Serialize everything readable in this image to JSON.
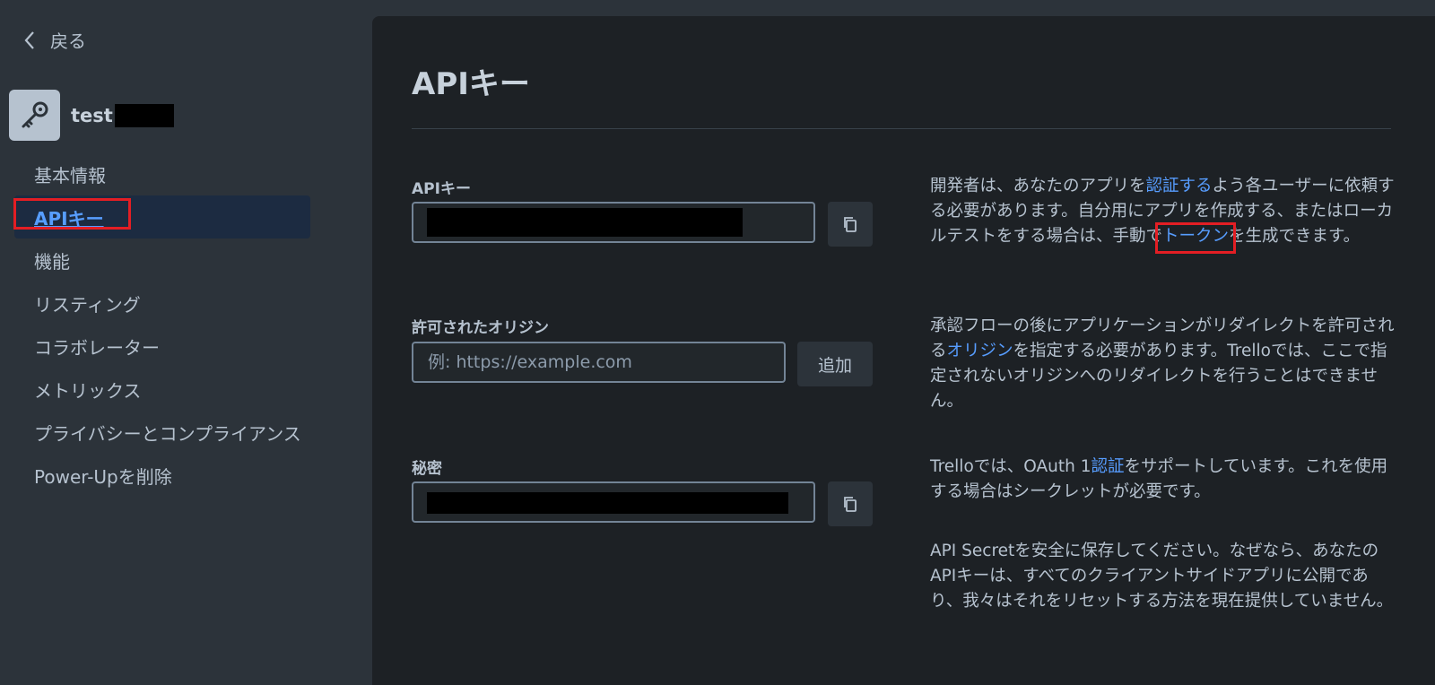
{
  "sidebar": {
    "back_label": "戻る",
    "app_name": "test",
    "nav": [
      {
        "label": "基本情報"
      },
      {
        "label": "APIキー"
      },
      {
        "label": "機能"
      },
      {
        "label": "リスティング"
      },
      {
        "label": "コラボレーター"
      },
      {
        "label": "メトリックス"
      },
      {
        "label": "プライバシーとコンプライアンス"
      },
      {
        "label": "Power-Upを削除"
      }
    ],
    "active_index": 1
  },
  "main": {
    "title": "APIキー",
    "api_key": {
      "label": "APIキー",
      "desc_1": "開発者は、あなたのアプリを",
      "link_1": "認証する",
      "desc_2": "よう各ユーザーに依頼する必要があります。自分用にアプリを作成する、またはローカルテストをする場合は、手動で",
      "link_2": "トークン",
      "desc_3": "を生成できます。"
    },
    "origins": {
      "label": "許可されたオリジン",
      "placeholder": "例: https://example.com",
      "add_label": "追加",
      "desc_1": "承認フローの後にアプリケーションがリダイレクトを許可される",
      "link_1": "オリジン",
      "desc_2": "を指定する必要があります。Trelloでは、ここで指定されないオリジンへのリダイレクトを行うことはできません。"
    },
    "secret": {
      "label": "秘密",
      "desc_1": "Trelloでは、OAuth 1",
      "link_1": "認証",
      "desc_2": "をサポートしています。これを使用する場合はシークレットが必要です。",
      "desc_3": "API Secretを安全に保存してください。なぜなら、あなたのAPIキーは、すべてのクライアントサイドアプリに公開であり、我々はそれをリセットする方法を現在提供していません。"
    }
  },
  "colors": {
    "accent": "#579dff",
    "highlight": "#e31e24",
    "background": "#1d2125",
    "sidebar": "#2c333a"
  },
  "icons": {
    "back": "chevron-left-icon",
    "app": "key-icon",
    "copy": "copy-icon"
  }
}
